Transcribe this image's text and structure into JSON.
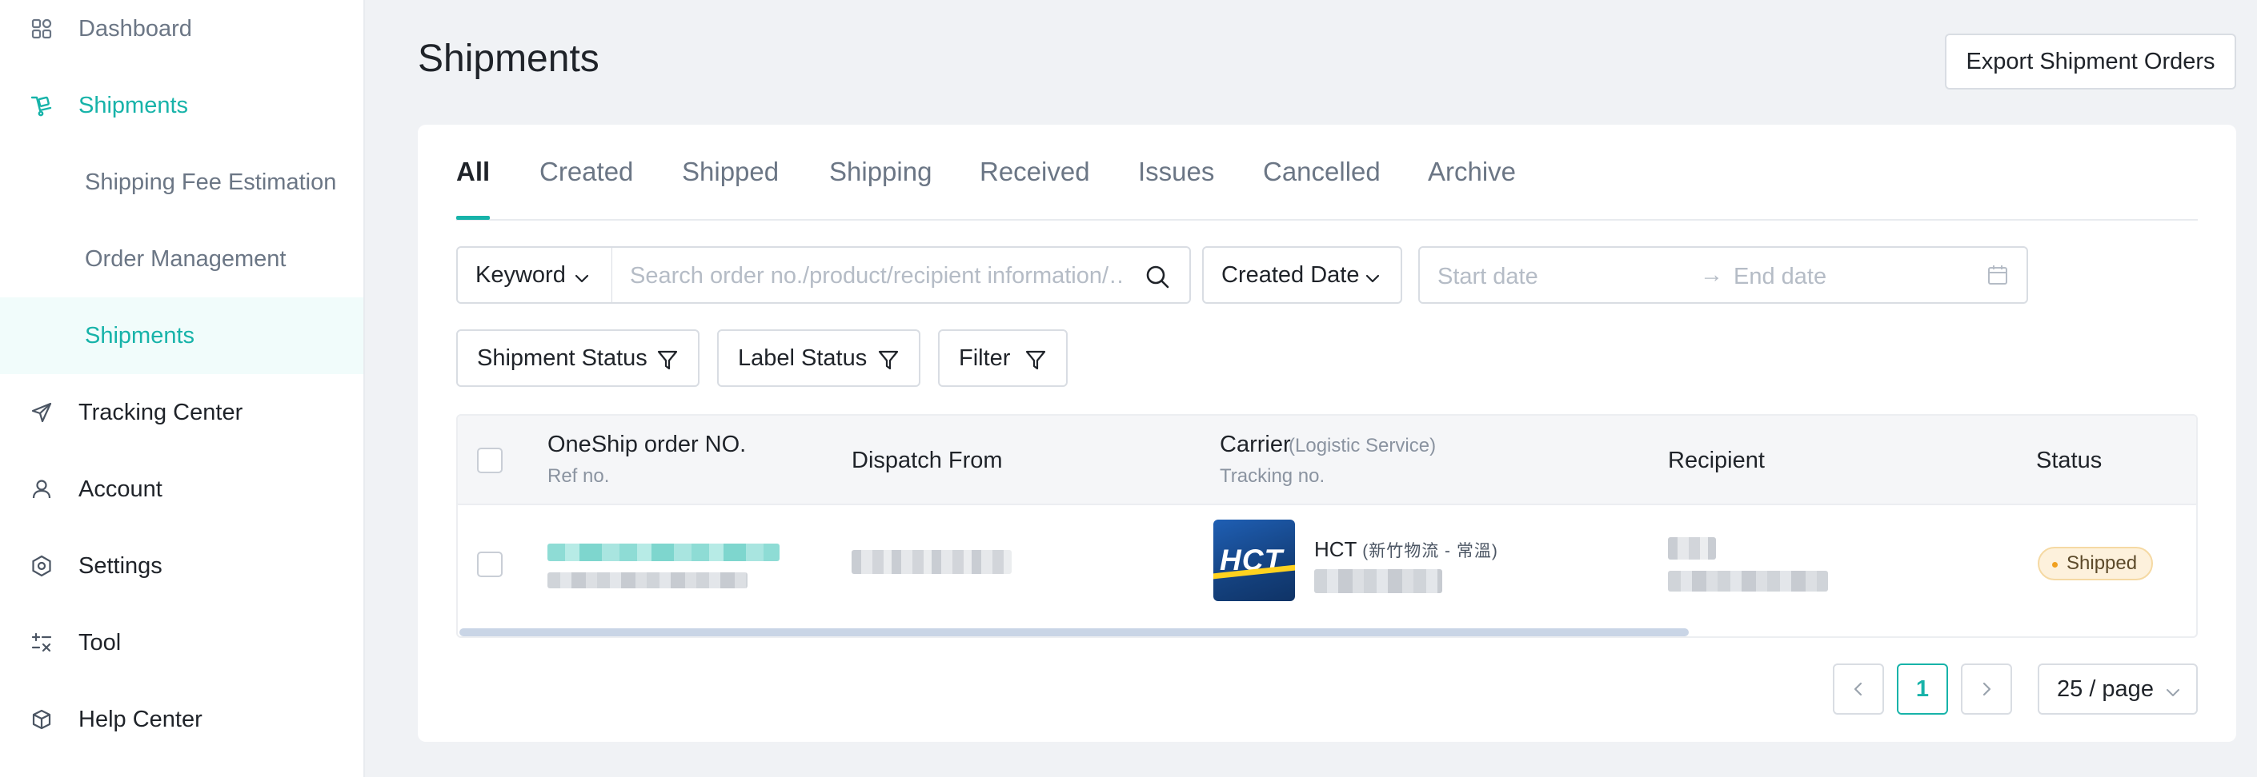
{
  "sidebar": {
    "items": [
      {
        "label": "Dashboard",
        "icon": "dashboard-icon"
      },
      {
        "label": "Shipments",
        "icon": "shipments-icon"
      },
      {
        "label": "Tracking Center",
        "icon": "send-icon"
      },
      {
        "label": "Account",
        "icon": "user-icon"
      },
      {
        "label": "Settings",
        "icon": "settings-icon"
      },
      {
        "label": "Tool",
        "icon": "tool-icon"
      },
      {
        "label": "Help Center",
        "icon": "box-icon"
      }
    ],
    "subitems": [
      {
        "label": "Shipping Fee Estimation"
      },
      {
        "label": "Order Management"
      },
      {
        "label": "Shipments"
      }
    ]
  },
  "header": {
    "title": "Shipments",
    "export_label": "Export Shipment Orders"
  },
  "tabs": [
    "All",
    "Created",
    "Shipped",
    "Shipping",
    "Received",
    "Issues",
    "Cancelled",
    "Archive"
  ],
  "filters": {
    "keyword_label": "Keyword",
    "search_placeholder": "Search order no./product/recipient information/…",
    "date_type_label": "Created Date",
    "start_placeholder": "Start date",
    "end_placeholder": "End date",
    "arrow": "→",
    "shipment_status_label": "Shipment Status",
    "label_status_label": "Label Status",
    "filter_label": "Filter"
  },
  "table": {
    "headers": {
      "order_no": "OneShip order NO.",
      "ref_no": "Ref no.",
      "dispatch_from": "Dispatch From",
      "carrier": "Carrier",
      "logistic_service": "(Logistic Service)",
      "tracking_no": "Tracking no.",
      "recipient": "Recipient",
      "status": "Status"
    },
    "rows": [
      {
        "carrier_logo_text": "HCT",
        "carrier_name": "HCT",
        "carrier_service": "(新竹物流 - 常溫)",
        "status": "Shipped"
      }
    ]
  },
  "pagination": {
    "prev": "<",
    "current_page": "1",
    "next": ">",
    "page_size": "25 / page"
  },
  "colors": {
    "accent": "#17b3a9",
    "status_shipped_bg": "#fdf1dc",
    "status_shipped_dot": "#f0a020"
  }
}
